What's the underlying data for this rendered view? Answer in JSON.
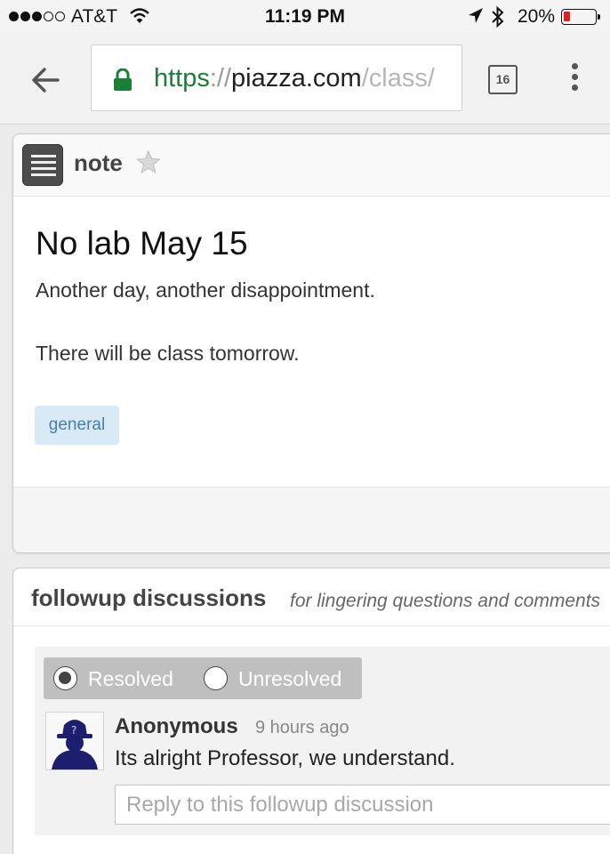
{
  "status_bar": {
    "carrier": "AT&T",
    "time": "11:19 PM",
    "battery_percent": "20%",
    "battery_level": 0.2,
    "signal_bars": 3,
    "signal_max": 5,
    "icons": [
      "signal-dots-icon",
      "wifi-icon",
      "location-arrow-icon",
      "bluetooth-icon",
      "battery-icon"
    ],
    "battery_color": "#e02020"
  },
  "browser": {
    "url_scheme": "https",
    "url_sep": "://",
    "url_host": "piazza.com",
    "url_path": "/class/",
    "tab_count": "16",
    "icons": [
      "back-arrow-icon",
      "lock-icon",
      "overflow-menu-icon"
    ],
    "secure_color": "#1a7f37"
  },
  "note": {
    "type_label": "note",
    "title": "No lab May 15",
    "paragraphs": [
      "Another day, another disappointment.",
      "There will be class tomorrow."
    ],
    "tag": "general",
    "icons": [
      "note-icon",
      "star-icon"
    ]
  },
  "followups": {
    "title": "followup discussions",
    "subtitle": "for lingering questions and comments",
    "resolved_label": "Resolved",
    "unresolved_label": "Unresolved",
    "selected": "Resolved",
    "thread": {
      "author": "Anonymous",
      "time_ago": "9 hours ago",
      "text": "Its alright Professor, we understand.",
      "avatar_icon": "anonymous-avatar-icon"
    },
    "reply_placeholder": "Reply to this followup discussion"
  }
}
